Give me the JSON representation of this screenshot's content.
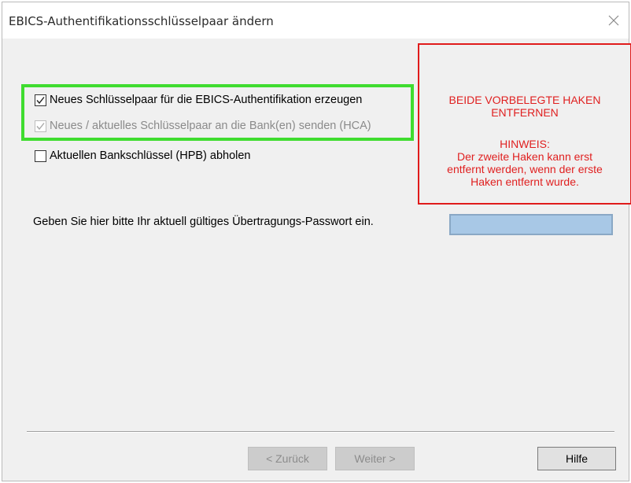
{
  "window": {
    "title": "EBICS-Authentifikationsschlüsselpaar ändern"
  },
  "options": [
    {
      "label": "Neues Schlüsselpaar für die EBICS-Authentifikation erzeugen",
      "checked": true,
      "enabled": true
    },
    {
      "label": "Neues / aktuelles Schlüsselpaar an die Bank(en) senden (HCA)",
      "checked": true,
      "enabled": false
    },
    {
      "label": "Aktuellen Bankschlüssel (HPB) abholen",
      "checked": false,
      "enabled": true
    }
  ],
  "annotation": {
    "title_lines": [
      "BEIDE VORBELEGTE HAKEN",
      "ENTFERNEN"
    ],
    "hint_lines": [
      "HINWEIS:",
      "Der zweite Haken kann erst",
      "entfernt werden, wenn der erste",
      "Haken entfernt wurde."
    ],
    "color": "#e02020",
    "highlight_color": "#3fdc2f"
  },
  "password": {
    "label": "Geben Sie hier bitte Ihr aktuell gültiges Übertragungs-Passwort ein.",
    "value": ""
  },
  "buttons": {
    "back": "< Zurück",
    "next": "Weiter >",
    "help": "Hilfe"
  },
  "icons": {
    "close": "close-icon",
    "check": "checkmark-icon"
  }
}
